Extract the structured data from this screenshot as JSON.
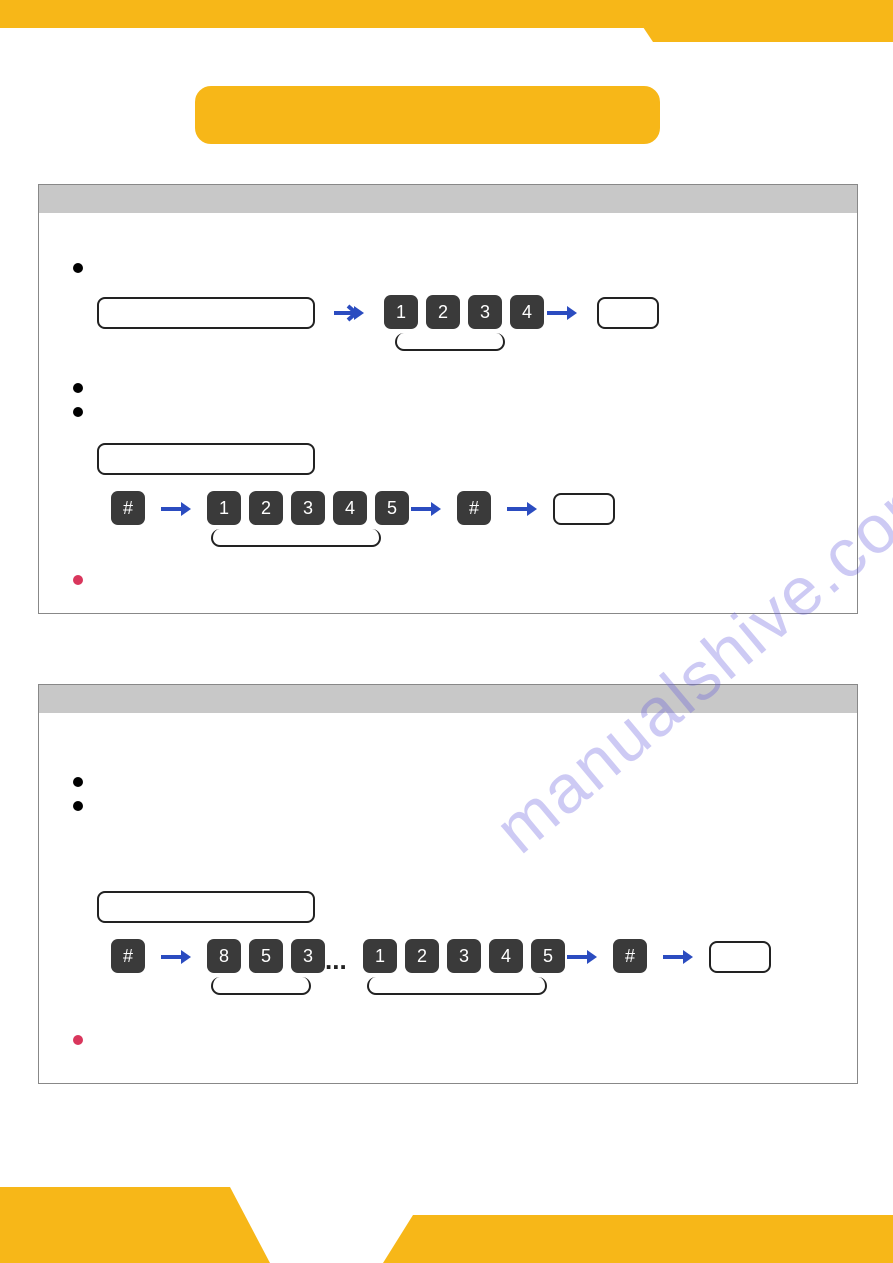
{
  "decorations": {
    "accent_color": "#f7b718",
    "watermark_text": "manualshive.com"
  },
  "panel1": {
    "row1": {
      "keys": [
        "1",
        "2",
        "3",
        "4"
      ]
    },
    "row2": {
      "hash1": "#",
      "keys": [
        "1",
        "2",
        "3",
        "4",
        "5"
      ],
      "hash2": "#"
    }
  },
  "panel2": {
    "row": {
      "hash1": "#",
      "keys_a": [
        "8",
        "5",
        "3"
      ],
      "ellipsis": "...",
      "keys_b": [
        "1",
        "2",
        "3",
        "4",
        "5"
      ],
      "hash2": "#"
    }
  }
}
